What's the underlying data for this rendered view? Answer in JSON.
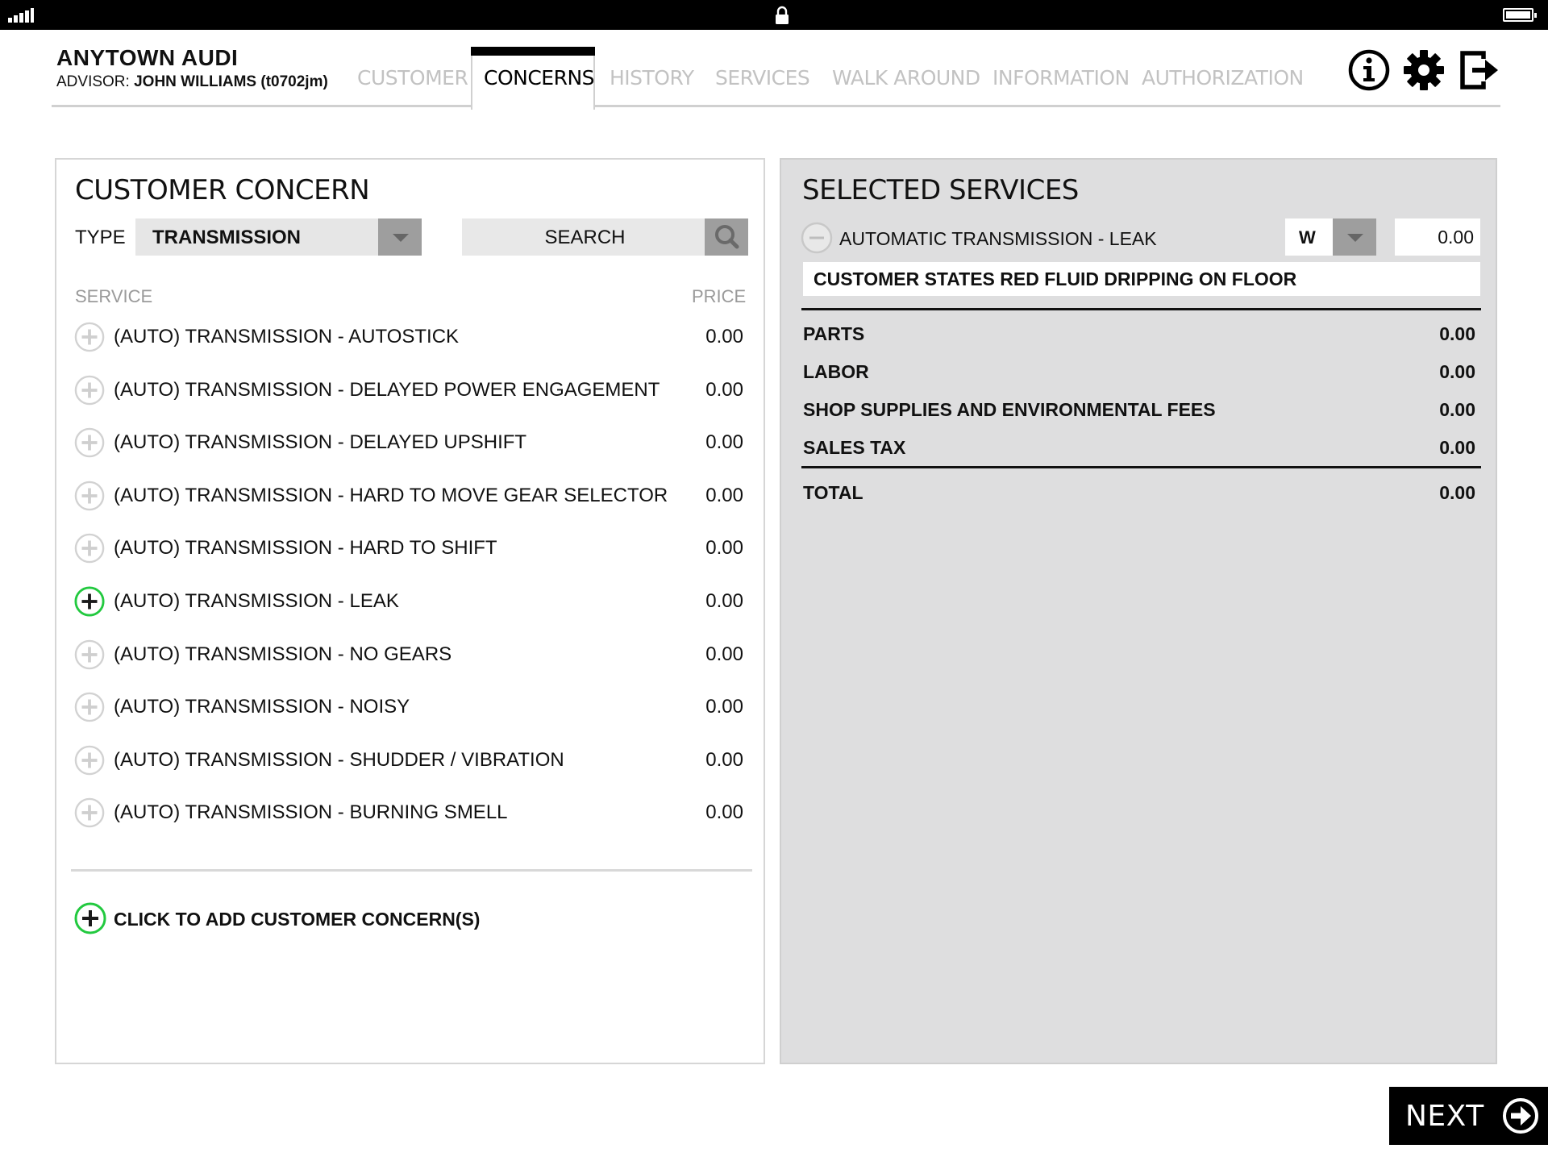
{
  "header": {
    "dealer_name": "ANYTOWN AUDI",
    "advisor_label": "ADVISOR:",
    "advisor_name": "JOHN WILLIAMS (t0702jm)"
  },
  "tabs": [
    {
      "label": "CUSTOMER",
      "active": false
    },
    {
      "label": "CONCERNS",
      "active": true
    },
    {
      "label": "HISTORY",
      "active": false
    },
    {
      "label": "SERVICES",
      "active": false
    },
    {
      "label": "WALK AROUND",
      "active": false
    },
    {
      "label": "INFORMATION",
      "active": false
    },
    {
      "label": "AUTHORIZATION",
      "active": false
    }
  ],
  "header_icons": [
    "info-icon",
    "gear-icon",
    "logout-icon"
  ],
  "concern_panel": {
    "title": "CUSTOMER CONCERN",
    "type_label": "TYPE",
    "type_value": "TRANSMISSION",
    "search_label": "SEARCH",
    "col_service": "SERVICE",
    "col_price": "PRICE",
    "services": [
      {
        "name": "(AUTO) TRANSMISSION - AUTOSTICK",
        "price": "0.00",
        "selected": false
      },
      {
        "name": "(AUTO) TRANSMISSION - DELAYED POWER ENGAGEMENT",
        "price": "0.00",
        "selected": false
      },
      {
        "name": "(AUTO) TRANSMISSION - DELAYED UPSHIFT",
        "price": "0.00",
        "selected": false
      },
      {
        "name": "(AUTO) TRANSMISSION - HARD TO MOVE GEAR SELECTOR",
        "price": "0.00",
        "selected": false
      },
      {
        "name": "(AUTO) TRANSMISSION - HARD TO SHIFT",
        "price": "0.00",
        "selected": false
      },
      {
        "name": "(AUTO) TRANSMISSION - LEAK",
        "price": "0.00",
        "selected": true
      },
      {
        "name": "(AUTO) TRANSMISSION - NO GEARS",
        "price": "0.00",
        "selected": false
      },
      {
        "name": "(AUTO) TRANSMISSION - NOISY",
        "price": "0.00",
        "selected": false
      },
      {
        "name": "(AUTO) TRANSMISSION - SHUDDER / VIBRATION",
        "price": "0.00",
        "selected": false
      },
      {
        "name": "(AUTO) TRANSMISSION - BURNING SMELL",
        "price": "0.00",
        "selected": false
      }
    ],
    "add_label": "CLICK TO ADD CUSTOMER CONCERN(S)"
  },
  "selected_panel": {
    "title": "SELECTED SERVICES",
    "service_name": "AUTOMATIC TRANSMISSION - LEAK",
    "pay_type": "W",
    "price": "0.00",
    "note": "CUSTOMER STATES RED FLUID DRIPPING ON FLOOR",
    "summary": [
      {
        "label": "PARTS",
        "value": "0.00"
      },
      {
        "label": "LABOR",
        "value": "0.00"
      },
      {
        "label": "SHOP SUPPLIES AND ENVIRONMENTAL FEES",
        "value": "0.00"
      },
      {
        "label": "SALES TAX",
        "value": "0.00"
      }
    ],
    "total_label": "TOTAL",
    "total_value": "0.00"
  },
  "next_label": "NEXT",
  "colors": {
    "accent_green": "#22c93f",
    "tab_inactive": "#c2c2c2",
    "panel_grey": "#dededf"
  }
}
